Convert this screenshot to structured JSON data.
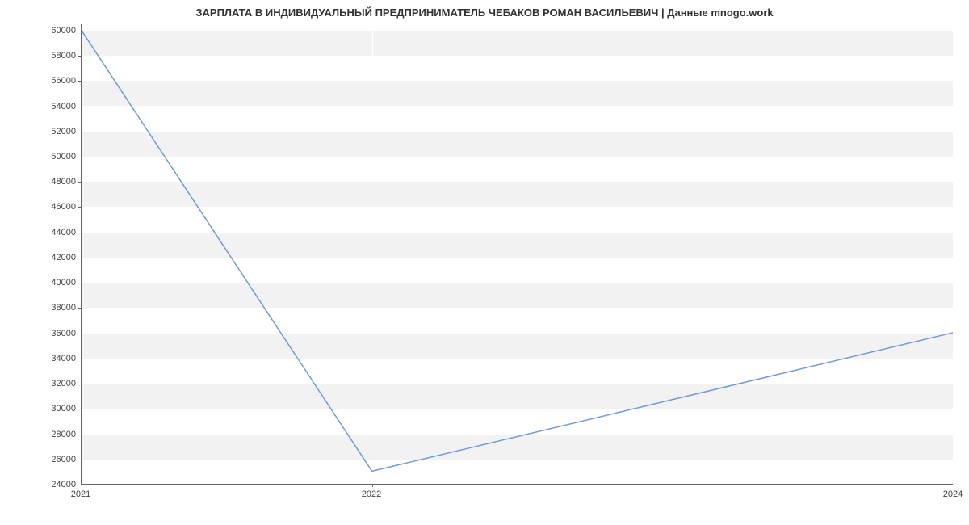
{
  "chart_data": {
    "type": "line",
    "title": "ЗАРПЛАТА В ИНДИВИДУАЛЬНЫЙ ПРЕДПРИНИМАТЕЛЬ ЧЕБАКОВ РОМАН ВАСИЛЬЕВИЧ | Данные mnogo.work",
    "xlabel": "",
    "ylabel": "",
    "x": [
      2021,
      2022,
      2024
    ],
    "values": [
      60000,
      25000,
      36000
    ],
    "y_ticks": [
      24000,
      26000,
      28000,
      30000,
      32000,
      34000,
      36000,
      38000,
      40000,
      42000,
      44000,
      46000,
      48000,
      50000,
      52000,
      54000,
      56000,
      58000,
      60000
    ],
    "x_ticks": [
      2021,
      2022,
      2024
    ],
    "ylim": [
      24000,
      60500
    ],
    "xlim": [
      2021,
      2024
    ],
    "grid": true,
    "line_color": "#6f9bd8"
  }
}
